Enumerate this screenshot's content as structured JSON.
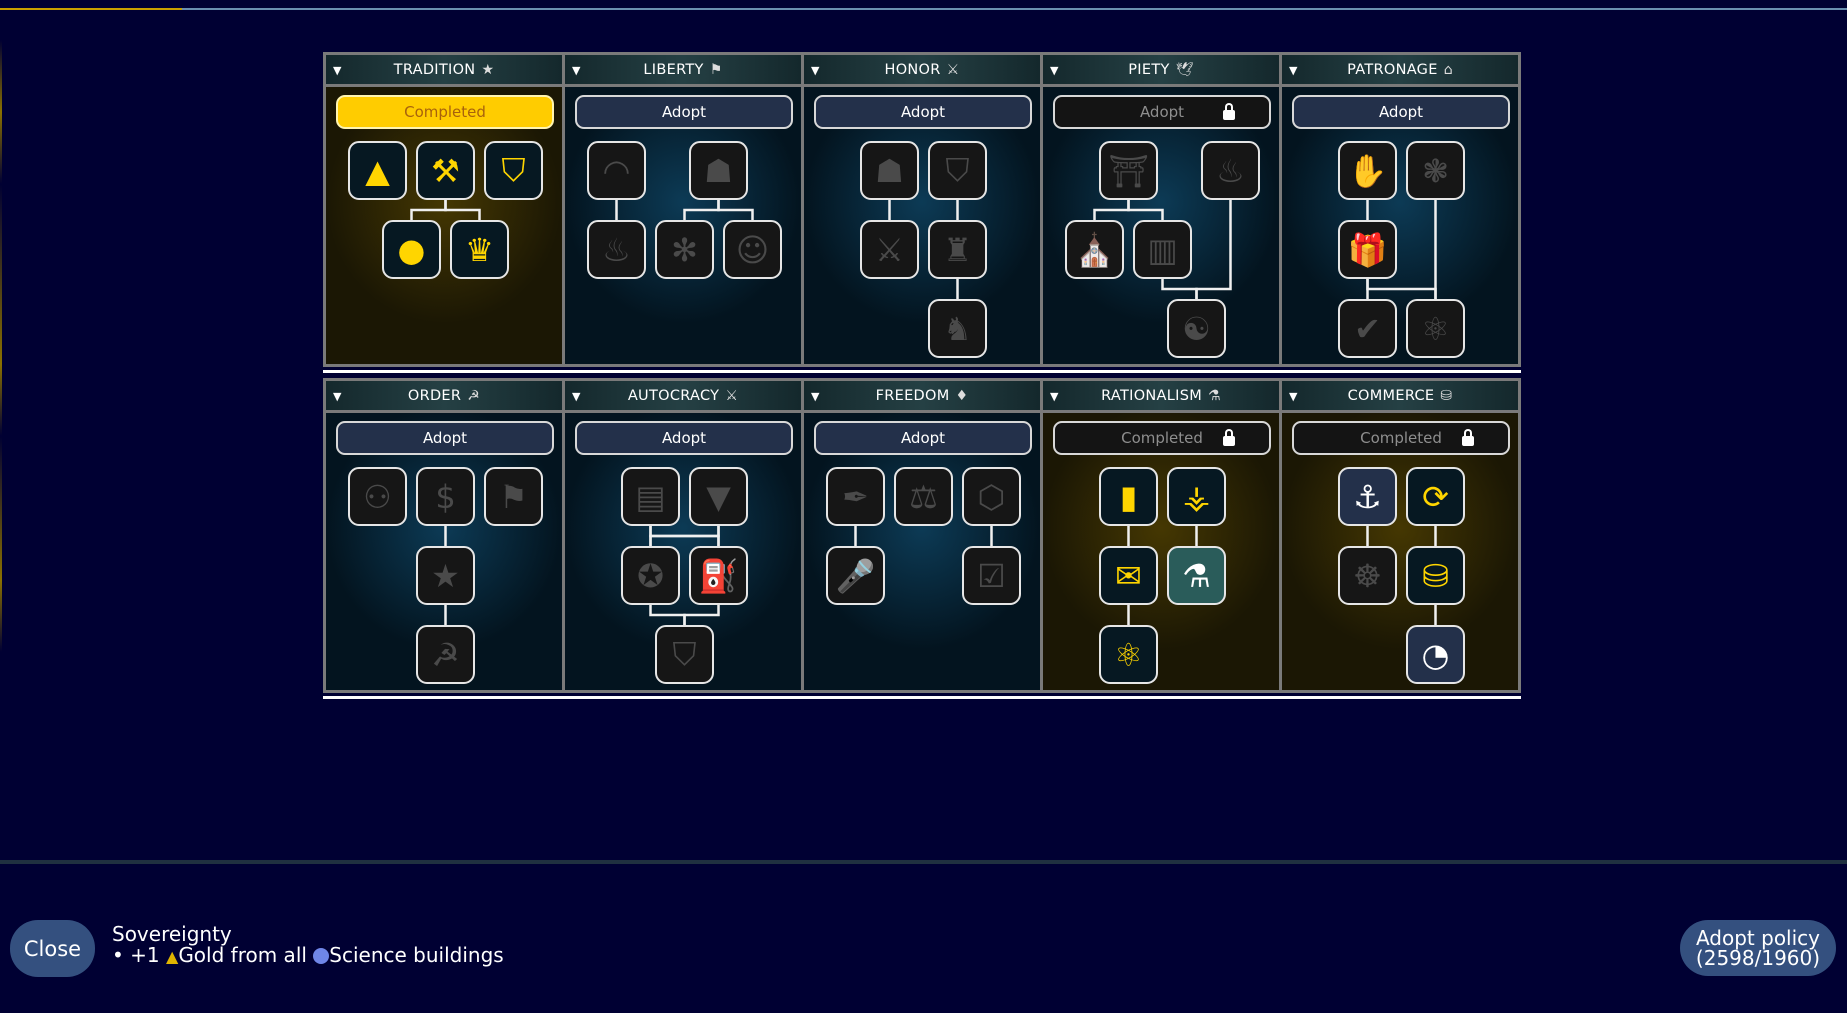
{
  "policy_rows": [
    [
      {
        "name": "TRADITION",
        "header_icon": "star-icon",
        "glyph": "★",
        "status": "completed",
        "button": "Completed",
        "locked": false,
        "nodes": [
          {
            "icon": "pyramid-icon",
            "glyph": "▲",
            "state": "adopted"
          },
          {
            "icon": "gavel-icon",
            "glyph": "⚒",
            "state": "adopted"
          },
          {
            "icon": "shield-icon",
            "glyph": "⛉",
            "state": "adopted"
          },
          {
            "icon": "apple-icon",
            "glyph": "●",
            "state": "adopted"
          },
          {
            "icon": "crown-icon",
            "glyph": "♛",
            "state": "adopted"
          }
        ],
        "edges": [
          [
            1,
            3
          ],
          [
            1,
            4
          ]
        ]
      },
      {
        "name": "LIBERTY",
        "header_icon": "flag-icon",
        "glyph": "⚑",
        "status": "available",
        "button": "Adopt",
        "locked": false,
        "nodes": [
          {
            "icon": "parliament-icon",
            "glyph": "◠",
            "state": "none"
          },
          {
            "icon": "people-icon",
            "glyph": "☗",
            "state": "none"
          },
          {
            "icon": "torch-icon",
            "glyph": "♨",
            "state": "none"
          },
          {
            "icon": "network-icon",
            "glyph": "✻",
            "state": "none"
          },
          {
            "icon": "community-icon",
            "glyph": "☺",
            "state": "none"
          }
        ],
        "edges": [
          [
            0,
            2
          ],
          [
            1,
            3
          ],
          [
            1,
            4
          ]
        ]
      },
      {
        "name": "HONOR",
        "header_icon": "crossed-swords-icon",
        "glyph": "⚔",
        "status": "available",
        "button": "Adopt",
        "locked": false,
        "nodes": [
          {
            "icon": "helmet-icon",
            "glyph": "☗",
            "state": "none"
          },
          {
            "icon": "shield-icon",
            "glyph": "⛉",
            "state": "none"
          },
          {
            "icon": "swords-icon",
            "glyph": "⚔",
            "state": "none"
          },
          {
            "icon": "fortress-icon",
            "glyph": "♜",
            "state": "none"
          },
          {
            "icon": "statue-icon",
            "glyph": "♞",
            "state": "none"
          }
        ],
        "edges": [
          [
            0,
            2
          ],
          [
            1,
            3
          ],
          [
            3,
            4
          ]
        ]
      },
      {
        "name": "PIETY",
        "header_icon": "dove-icon",
        "glyph": "🕊",
        "status": "locked",
        "button": "Adopt",
        "locked": true,
        "nodes": [
          {
            "icon": "ark-icon",
            "glyph": "⛩",
            "state": "none"
          },
          {
            "icon": "flame-icon",
            "glyph": "♨",
            "state": "none"
          },
          {
            "icon": "temple-icon",
            "glyph": "⛪",
            "state": "none"
          },
          {
            "icon": "pillars-icon",
            "glyph": "▥",
            "state": "none"
          },
          {
            "icon": "religions-icon",
            "glyph": "☯",
            "state": "none"
          }
        ],
        "edges": [
          [
            0,
            2
          ],
          [
            0,
            3
          ],
          [
            3,
            4
          ],
          [
            1,
            4
          ]
        ]
      },
      {
        "name": "PATRONAGE",
        "header_icon": "capitol-icon",
        "glyph": "⌂",
        "status": "available",
        "button": "Adopt",
        "locked": false,
        "nodes": [
          {
            "icon": "gold-hand-icon",
            "glyph": "✋",
            "state": "none"
          },
          {
            "icon": "flower-network-icon",
            "glyph": "❃",
            "state": "none"
          },
          {
            "icon": "gift-icon",
            "glyph": "🎁",
            "state": "none"
          },
          {
            "icon": "speech-check-icon",
            "glyph": "✔",
            "state": "none"
          },
          {
            "icon": "teacher-icon",
            "glyph": "⚛",
            "state": "none"
          }
        ],
        "edges": [
          [
            0,
            2
          ],
          [
            2,
            3
          ],
          [
            2,
            4
          ],
          [
            1,
            4
          ]
        ]
      }
    ],
    [
      {
        "name": "ORDER",
        "header_icon": "hammer-sickle-icon",
        "glyph": "☭",
        "status": "available",
        "button": "Adopt",
        "locked": false,
        "nodes": [
          {
            "icon": "hierarchy-icon",
            "glyph": "⚇",
            "state": "none"
          },
          {
            "icon": "trade-route-icon",
            "glyph": "$",
            "state": "none"
          },
          {
            "icon": "flag-icon",
            "glyph": "⚑",
            "state": "none"
          },
          {
            "icon": "star-icon",
            "glyph": "★",
            "state": "none"
          },
          {
            "icon": "hammer-sickle-icon",
            "glyph": "☭",
            "state": "none"
          }
        ],
        "edges": [
          [
            1,
            3
          ],
          [
            3,
            4
          ]
        ]
      },
      {
        "name": "AUTOCRACY",
        "header_icon": "sword-icon",
        "glyph": "⚔",
        "status": "available",
        "button": "Adopt",
        "locked": false,
        "nodes": [
          {
            "icon": "newspaper-icon",
            "glyph": "▤",
            "state": "none"
          },
          {
            "icon": "rank-icon",
            "glyph": "▼",
            "state": "none"
          },
          {
            "icon": "medal-icon",
            "glyph": "✪",
            "state": "none"
          },
          {
            "icon": "tank-icon",
            "glyph": "⛽",
            "state": "none"
          },
          {
            "icon": "shield-icon",
            "glyph": "⛉",
            "state": "none"
          }
        ],
        "edges": [
          [
            0,
            2
          ],
          [
            1,
            3
          ],
          [
            0,
            3
          ],
          [
            1,
            2
          ],
          [
            2,
            4
          ],
          [
            3,
            4
          ]
        ]
      },
      {
        "name": "FREEDOM",
        "header_icon": "torch-icon",
        "glyph": "♦",
        "status": "available",
        "button": "Adopt",
        "locked": false,
        "nodes": [
          {
            "icon": "quill-icon",
            "glyph": "✒",
            "state": "none"
          },
          {
            "icon": "equality-icon",
            "glyph": "⚖",
            "state": "none"
          },
          {
            "icon": "network-icon",
            "glyph": "⬡",
            "state": "none"
          },
          {
            "icon": "microphone-icon",
            "glyph": "🎤",
            "state": "none"
          },
          {
            "icon": "ballot-box-icon",
            "glyph": "☑",
            "state": "none"
          }
        ],
        "edges": [
          [
            0,
            3
          ],
          [
            2,
            4
          ]
        ]
      },
      {
        "name": "RATIONALISM",
        "header_icon": "flask-icon",
        "glyph": "⚗",
        "status": "completed-locked",
        "button": "Completed",
        "locked": true,
        "nodes": [
          {
            "icon": "bar-chart-icon",
            "glyph": "▮",
            "state": "adopted"
          },
          {
            "icon": "decision-tree-icon",
            "glyph": "⚶",
            "state": "adopted"
          },
          {
            "icon": "chat-icon",
            "glyph": "✉",
            "state": "adopted"
          },
          {
            "icon": "flask-icon",
            "glyph": "⚗",
            "state": "nextteal"
          },
          {
            "icon": "atom-icon",
            "glyph": "⚛",
            "state": "adopted"
          }
        ],
        "edges": [
          [
            0,
            2
          ],
          [
            1,
            3
          ],
          [
            2,
            4
          ]
        ]
      },
      {
        "name": "COMMERCE",
        "header_icon": "coins-icon",
        "glyph": "⛁",
        "status": "completed-locked",
        "button": "Completed",
        "locked": true,
        "nodes": [
          {
            "icon": "sextant-icon",
            "glyph": "⚓",
            "state": "next"
          },
          {
            "icon": "handshake-icon",
            "glyph": "⟳",
            "state": "adopted"
          },
          {
            "icon": "merchant-icon",
            "glyph": "☸",
            "state": "none"
          },
          {
            "icon": "coins-icon",
            "glyph": "⛁",
            "state": "adopted"
          },
          {
            "icon": "pie-chart-icon",
            "glyph": "◔",
            "state": "next"
          }
        ],
        "edges": [
          [
            0,
            2
          ],
          [
            1,
            3
          ],
          [
            3,
            4
          ]
        ]
      }
    ]
  ],
  "footer": {
    "close_label": "Close",
    "policy_name": "Sovereignty",
    "effect_prefix": "• +1 ",
    "gold_label": "Gold from all ",
    "science_label": "Science buildings",
    "adopt_label": "Adopt policy",
    "adopt_cost": "(2598/1960)"
  },
  "colors": {
    "background": "#000033",
    "adopted": "#ffd500",
    "adopt_button": "#23304a",
    "footer_button": "#34507f"
  }
}
